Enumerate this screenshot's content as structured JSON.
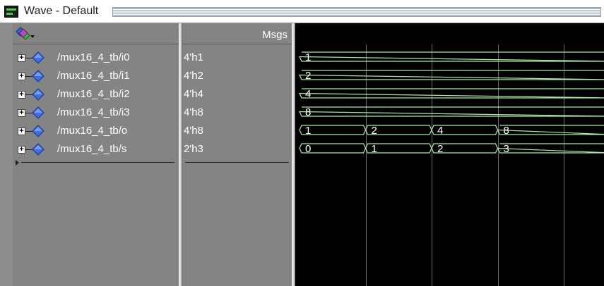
{
  "window": {
    "title": "Wave - Default"
  },
  "header": {
    "msgs_label": "Msgs"
  },
  "signals": [
    {
      "name": "/mux16_4_tb/i0",
      "value": "4'h1",
      "segments": [
        {
          "start": 0,
          "label": "1"
        }
      ]
    },
    {
      "name": "/mux16_4_tb/i1",
      "value": "4'h2",
      "segments": [
        {
          "start": 0,
          "label": "2"
        }
      ]
    },
    {
      "name": "/mux16_4_tb/i2",
      "value": "4'h4",
      "segments": [
        {
          "start": 0,
          "label": "4"
        }
      ]
    },
    {
      "name": "/mux16_4_tb/i3",
      "value": "4'h8",
      "segments": [
        {
          "start": 0,
          "label": "8"
        }
      ]
    },
    {
      "name": "/mux16_4_tb/o",
      "value": "4'h8",
      "segments": [
        {
          "start": 0,
          "label": "1"
        },
        {
          "start": 1,
          "label": "2"
        },
        {
          "start": 2,
          "label": "4"
        },
        {
          "start": 3,
          "label": "8"
        }
      ]
    },
    {
      "name": "/mux16_4_tb/s",
      "value": "2'h3",
      "segments": [
        {
          "start": 0,
          "label": "0"
        },
        {
          "start": 1,
          "label": "1"
        },
        {
          "start": 2,
          "label": "2"
        },
        {
          "start": 3,
          "label": "3"
        }
      ]
    }
  ],
  "wave": {
    "interval_count": 4,
    "grid_lines": [
      1,
      2,
      3,
      4
    ]
  },
  "colors": {
    "wave": "#a6e9a6",
    "wave_text": "#ffffff",
    "grid": "#6e6e6e",
    "pane": "#848484",
    "wave_bg": "#000000"
  },
  "icons": {
    "window": "waveform-window-icon",
    "insert": "insert-signal-icon",
    "signal": "signal-diamond-icon",
    "expand": "expand-plus-icon"
  }
}
